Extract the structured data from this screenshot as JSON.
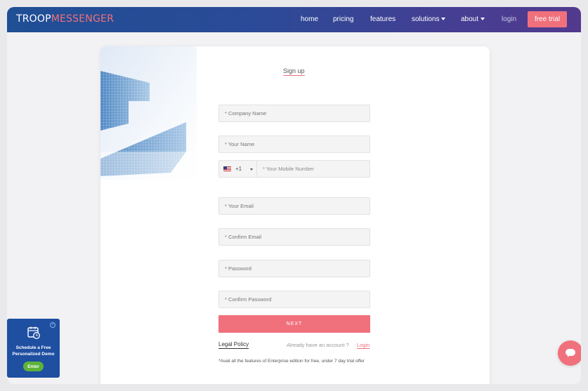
{
  "brand": {
    "name_part1": "TROOP",
    "name_part2": "MESSENGER",
    "accent": "#f0707c"
  },
  "nav": {
    "home": "home",
    "pricing": "pricing",
    "features": "features",
    "solutions": "solutions",
    "about": "about",
    "login": "login",
    "free_trial": "free trial"
  },
  "form": {
    "title": "Sign up",
    "company_placeholder": "* Company Name",
    "name_placeholder": "* Your Name",
    "country_code": "+1",
    "mobile_placeholder": "* Your Mobile Number",
    "email_placeholder": "* Your Email",
    "confirm_email_placeholder": "* Confirm Email",
    "password_placeholder": "* Password",
    "confirm_password_placeholder": "* Confirm Password",
    "next_label": "NEXT",
    "legal_policy": "Legal Policy",
    "have_account": "Already have an account ?",
    "login_link": "Login",
    "note": "*Avail all the features of Enterprise edition for free, under 7 day trial offer"
  },
  "demo_widget": {
    "line1": "Schedule a Free",
    "line2": "Personalized Demo",
    "enter_label": "Enter",
    "close_icon": "close-icon",
    "calendar_icon": "calendar-clock-icon"
  },
  "chat_icon": "chat-bubble-icon"
}
